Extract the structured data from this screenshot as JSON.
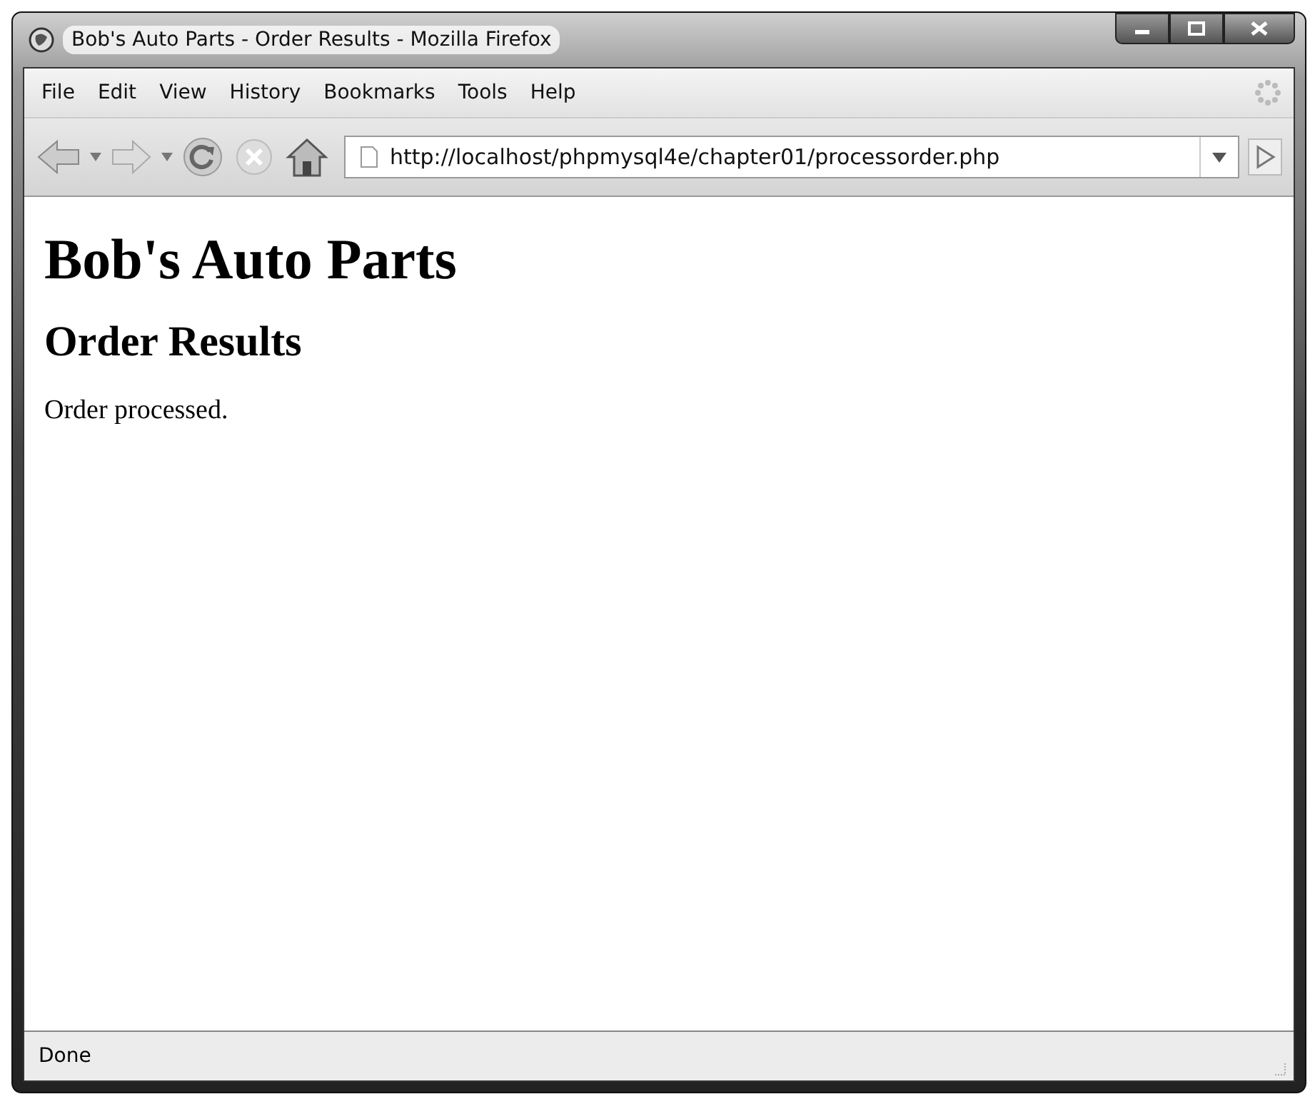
{
  "window": {
    "title": "Bob's Auto Parts - Order Results - Mozilla Firefox"
  },
  "menu": [
    "File",
    "Edit",
    "View",
    "History",
    "Bookmarks",
    "Tools",
    "Help"
  ],
  "address_bar": {
    "value": "http://localhost/phpmysql4e/chapter01/processorder.php"
  },
  "page": {
    "heading": "Bob's Auto Parts",
    "subheading": "Order Results",
    "text": "Order processed."
  },
  "status_bar": "Done"
}
